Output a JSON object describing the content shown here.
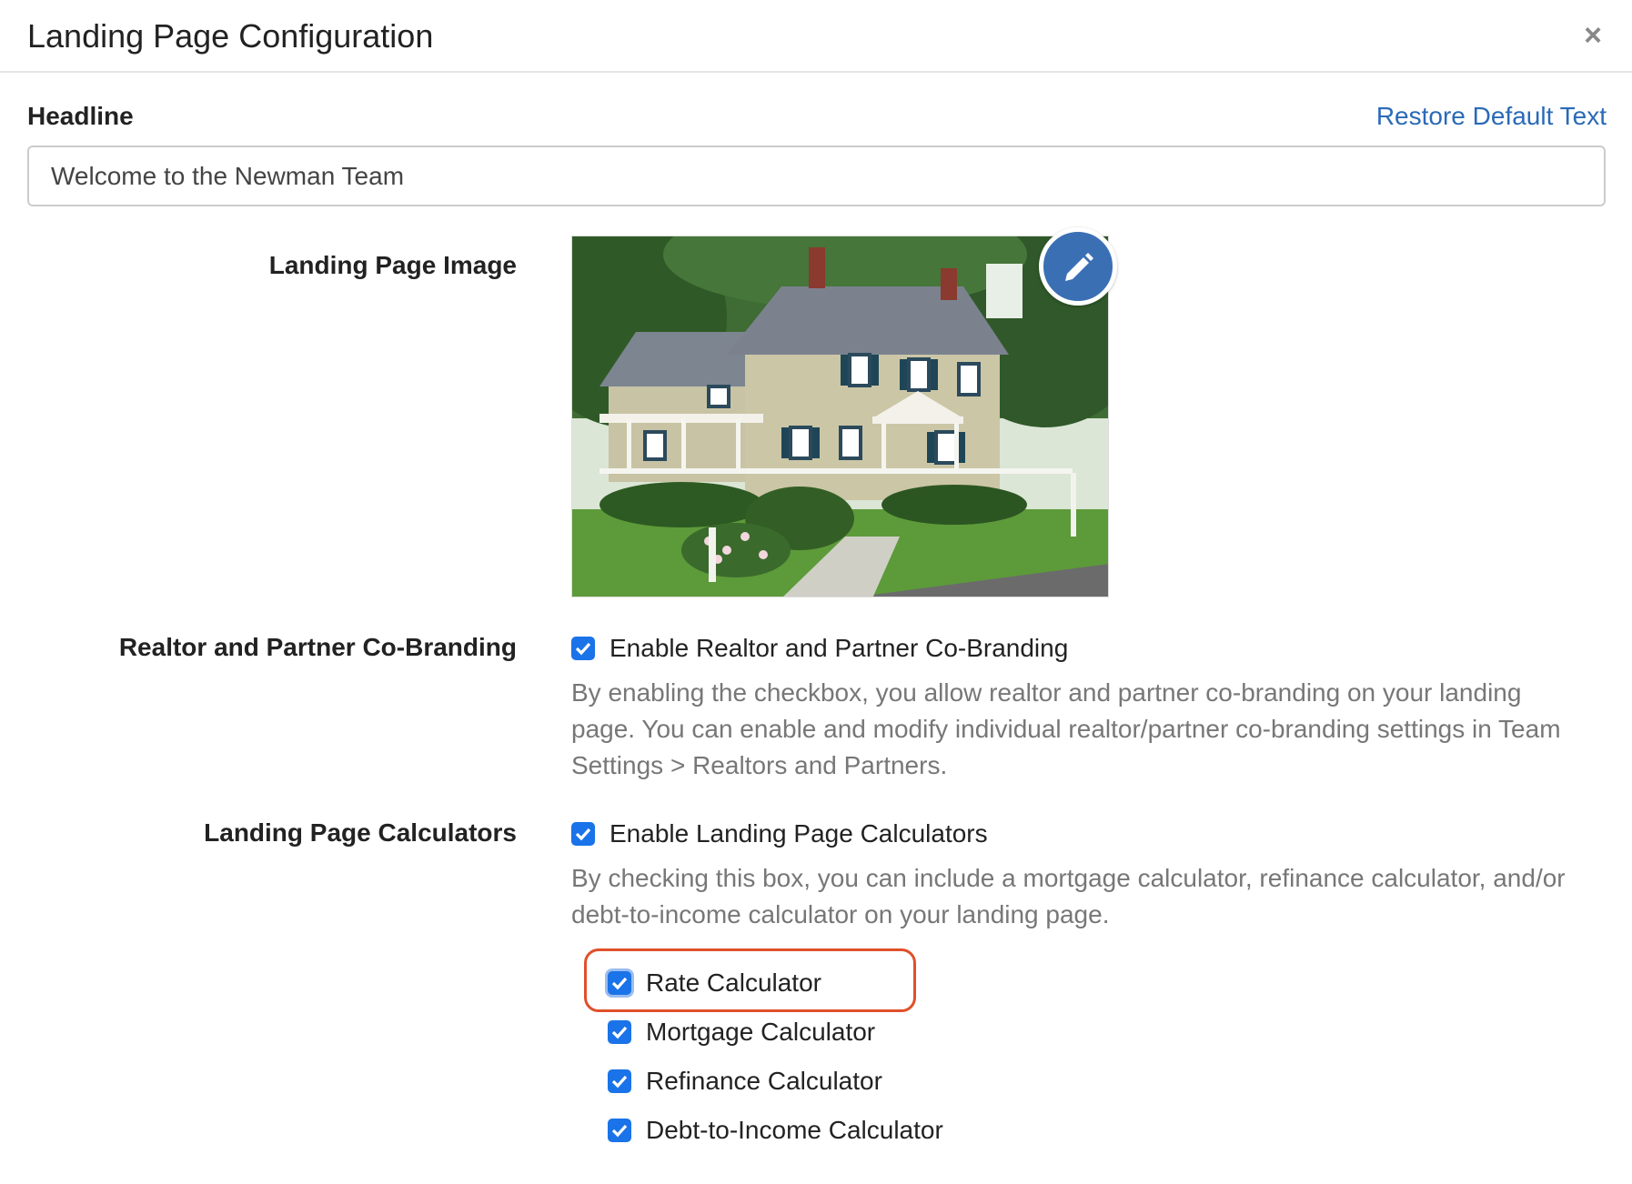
{
  "modal": {
    "title": "Landing Page Configuration",
    "close_icon": "close-icon"
  },
  "headline": {
    "label": "Headline",
    "restore_link": "Restore Default Text",
    "value": "Welcome to the Newman Team"
  },
  "image_section": {
    "label": "Landing Page Image",
    "edit_icon": "pencil-icon"
  },
  "cobranding": {
    "label": "Realtor and Partner Co-Branding",
    "checkbox_label": "Enable Realtor and Partner Co-Branding",
    "checked": true,
    "help_text": "By enabling the checkbox, you allow realtor and partner co-branding on your landing page. You can enable and modify individual realtor/partner co-branding settings in Team Settings > Realtors and Partners."
  },
  "calculators": {
    "label": "Landing Page Calculators",
    "checkbox_label": "Enable Landing Page Calculators",
    "checked": true,
    "help_text": "By checking this box, you can include a mortgage calculator, refinance calculator, and/or debt-to-income calculator on your landing page.",
    "options": [
      {
        "label": "Rate Calculator",
        "checked": true
      },
      {
        "label": "Mortgage Calculator",
        "checked": true
      },
      {
        "label": "Refinance Calculator",
        "checked": true
      },
      {
        "label": "Debt-to-Income Calculator",
        "checked": true
      }
    ]
  },
  "colors": {
    "link": "#2a6ab7",
    "checkbox": "#1a73e8",
    "edit_button": "#3a6fb4",
    "highlight": "#e0502a"
  }
}
